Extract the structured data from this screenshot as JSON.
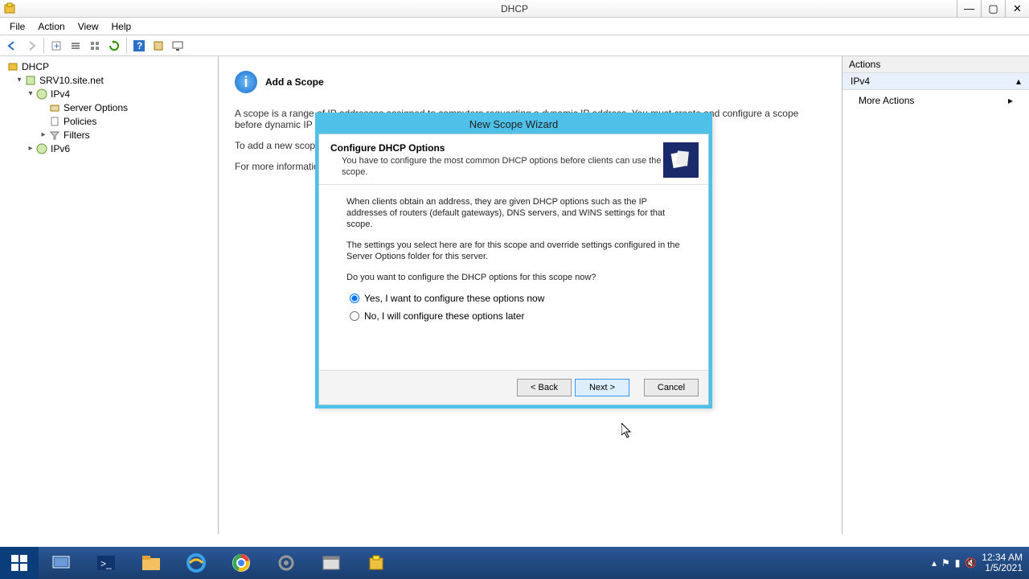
{
  "window": {
    "title": "DHCP"
  },
  "menu": {
    "file": "File",
    "action": "Action",
    "view": "View",
    "help": "Help"
  },
  "tree": {
    "root": "DHCP",
    "server": "SRV10.site.net",
    "ipv4": "IPv4",
    "server_options": "Server Options",
    "policies": "Policies",
    "filters": "Filters",
    "ipv6": "IPv6"
  },
  "center": {
    "heading": "Add a Scope",
    "para1": "A scope is a range of IP addresses assigned to computers requesting a dynamic IP address. You must create and configure a scope before dynamic IP addresses can be assigned.",
    "para2": "To add a new scope, on the Action menu, click New Scope.",
    "para3": "For more information about setting up a DHCP server, see online Help."
  },
  "actions": {
    "title": "Actions",
    "section": "IPv4",
    "more": "More Actions"
  },
  "wizard": {
    "title": "New Scope Wizard",
    "header": "Configure DHCP Options",
    "subheader": "You have to configure the most common DHCP options before clients can use the scope.",
    "body1": "When clients obtain an address, they are given DHCP options such as the IP addresses of routers (default gateways), DNS servers, and WINS settings for that scope.",
    "body2": "The settings you select here are for this scope and override settings configured in the Server Options folder for this server.",
    "body3": "Do you want to configure the DHCP options for this scope now?",
    "opt_yes": "Yes, I want to configure these options now",
    "opt_no": "No, I will configure these options later",
    "back": "< Back",
    "next": "Next >",
    "cancel": "Cancel"
  },
  "taskbar": {
    "time": "12:34 AM",
    "date": "1/5/2021"
  }
}
